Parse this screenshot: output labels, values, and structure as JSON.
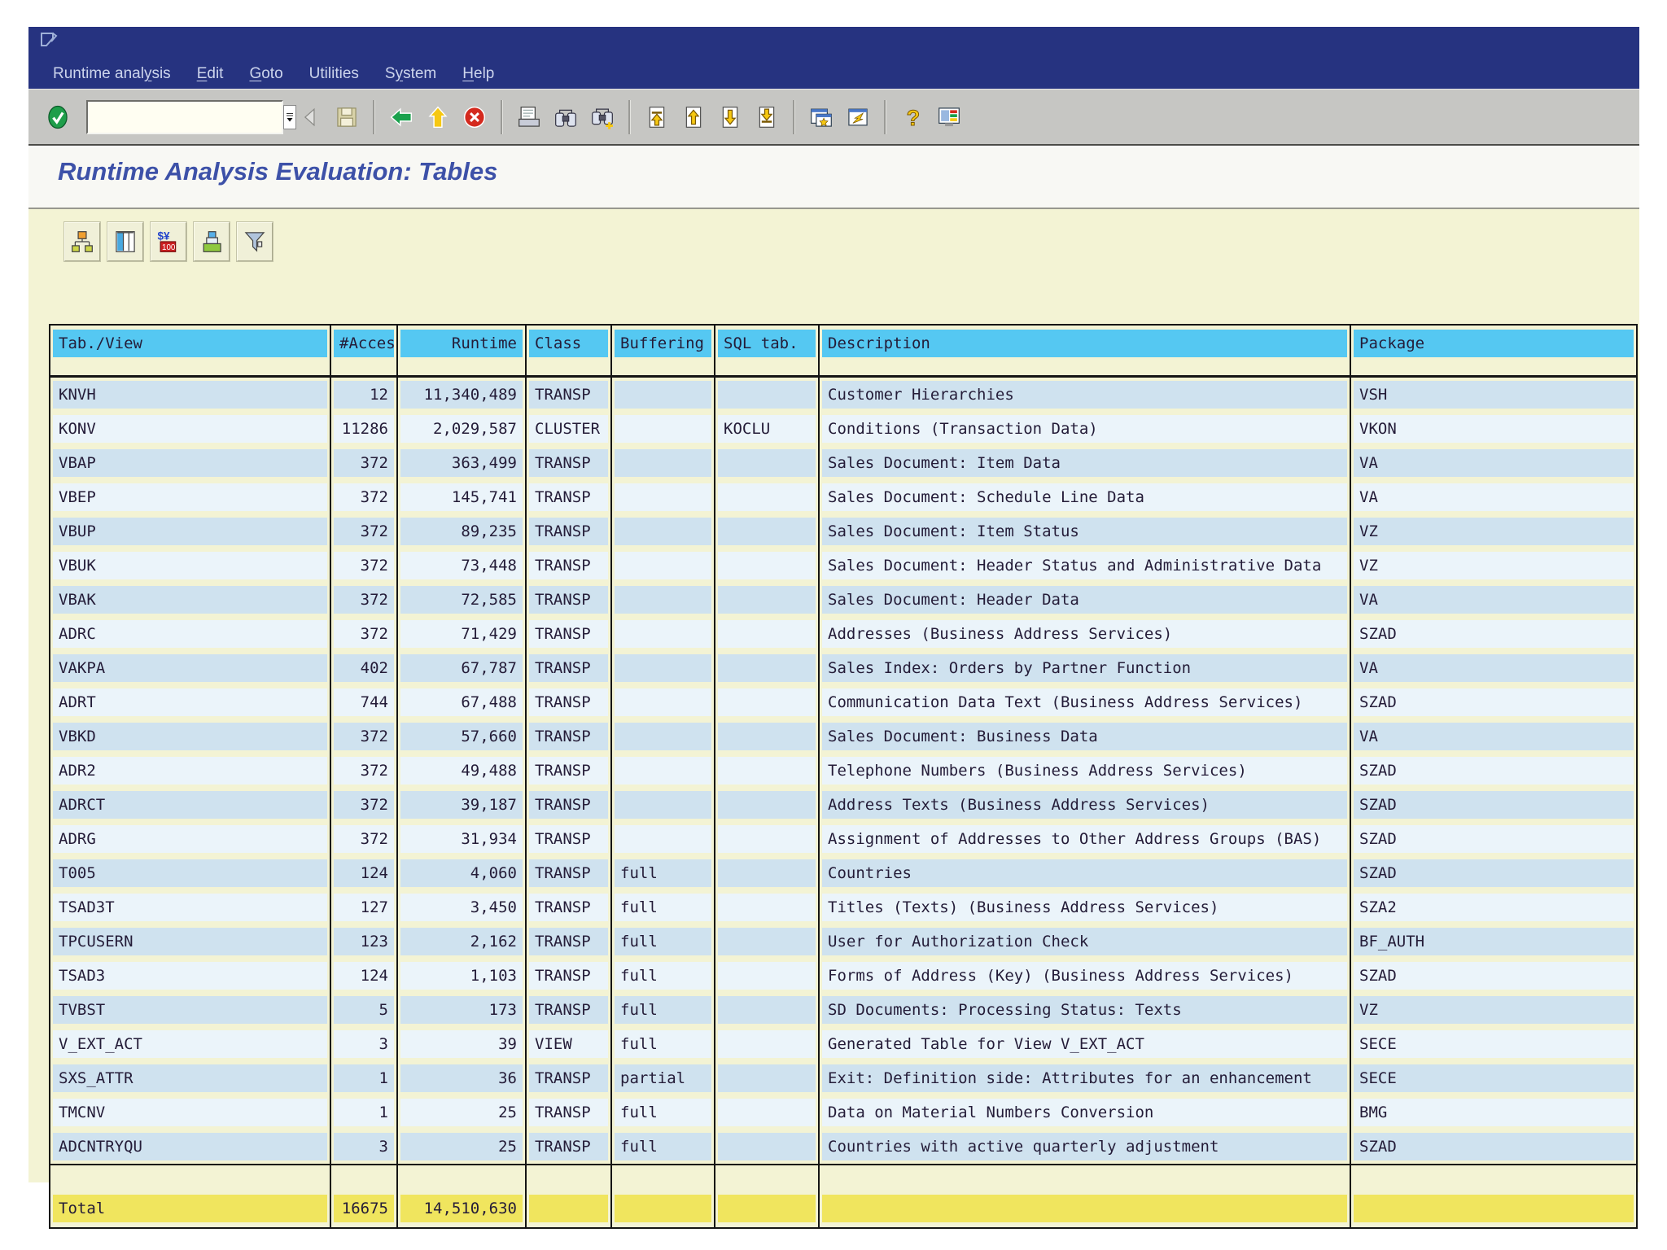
{
  "colors": {
    "titlebar": "#263380",
    "canvas": "#f3f3d4",
    "header_band": "#55c8f2",
    "row_odd": "#cfe2ef",
    "row_even": "#ebf4fa",
    "total_band": "#f0e55e",
    "title_text": "#3d51a8"
  },
  "menubar": {
    "items": [
      {
        "label": "Runtime analysis",
        "accel": 12
      },
      {
        "label": "Edit",
        "accel": 0
      },
      {
        "label": "Goto",
        "accel": 0
      },
      {
        "label": "Utilities",
        "accel": -1
      },
      {
        "label": "System",
        "accel": 1
      },
      {
        "label": "Help",
        "accel": 0
      }
    ]
  },
  "toolbar": {
    "command_value": "",
    "buttons": [
      "check",
      "command",
      "enter-arrow",
      "save",
      "sep",
      "back",
      "exit",
      "cancel",
      "sep",
      "print",
      "find",
      "find-next",
      "sep",
      "first-page",
      "page-up",
      "page-down",
      "last-page",
      "sep",
      "new-session",
      "shortcut",
      "sep",
      "help",
      "customize"
    ]
  },
  "page_title": "Runtime Analysis Evaluation: Tables",
  "app_toolbar": {
    "buttons": [
      "hierarchy",
      "table-view",
      "currency",
      "sort",
      "filter"
    ]
  },
  "table": {
    "columns": [
      {
        "key": "tab",
        "label": "Tab./View",
        "header_align": "left",
        "align": "left"
      },
      {
        "key": "acces",
        "label": "#Acces",
        "header_align": "left",
        "align": "right"
      },
      {
        "key": "runtime",
        "label": "Runtime",
        "header_align": "right",
        "align": "right"
      },
      {
        "key": "class",
        "label": "Class",
        "header_align": "left",
        "align": "left"
      },
      {
        "key": "buffering",
        "label": "Buffering",
        "header_align": "left",
        "align": "left"
      },
      {
        "key": "sql",
        "label": "SQL tab.",
        "header_align": "left",
        "align": "left"
      },
      {
        "key": "desc",
        "label": "Description",
        "header_align": "left",
        "align": "left"
      },
      {
        "key": "pkg",
        "label": "Package",
        "header_align": "left",
        "align": "left"
      }
    ],
    "rows": [
      {
        "tab": "KNVH",
        "acces": "12",
        "runtime": "11,340,489",
        "class": "TRANSP",
        "buffering": "",
        "sql": "",
        "desc": "Customer Hierarchies",
        "pkg": "VSH"
      },
      {
        "tab": "KONV",
        "acces": "11286",
        "runtime": "2,029,587",
        "class": "CLUSTER",
        "buffering": "",
        "sql": "KOCLU",
        "desc": "Conditions (Transaction Data)",
        "pkg": "VKON"
      },
      {
        "tab": "VBAP",
        "acces": "372",
        "runtime": "363,499",
        "class": "TRANSP",
        "buffering": "",
        "sql": "",
        "desc": "Sales Document: Item Data",
        "pkg": "VA"
      },
      {
        "tab": "VBEP",
        "acces": "372",
        "runtime": "145,741",
        "class": "TRANSP",
        "buffering": "",
        "sql": "",
        "desc": "Sales Document: Schedule Line Data",
        "pkg": "VA"
      },
      {
        "tab": "VBUP",
        "acces": "372",
        "runtime": "89,235",
        "class": "TRANSP",
        "buffering": "",
        "sql": "",
        "desc": "Sales Document: Item Status",
        "pkg": "VZ"
      },
      {
        "tab": "VBUK",
        "acces": "372",
        "runtime": "73,448",
        "class": "TRANSP",
        "buffering": "",
        "sql": "",
        "desc": "Sales Document: Header Status and Administrative Data",
        "pkg": "VZ"
      },
      {
        "tab": "VBAK",
        "acces": "372",
        "runtime": "72,585",
        "class": "TRANSP",
        "buffering": "",
        "sql": "",
        "desc": "Sales Document: Header Data",
        "pkg": "VA"
      },
      {
        "tab": "ADRC",
        "acces": "372",
        "runtime": "71,429",
        "class": "TRANSP",
        "buffering": "",
        "sql": "",
        "desc": "Addresses (Business Address Services)",
        "pkg": "SZAD"
      },
      {
        "tab": "VAKPA",
        "acces": "402",
        "runtime": "67,787",
        "class": "TRANSP",
        "buffering": "",
        "sql": "",
        "desc": "Sales Index: Orders by Partner Function",
        "pkg": "VA"
      },
      {
        "tab": "ADRT",
        "acces": "744",
        "runtime": "67,488",
        "class": "TRANSP",
        "buffering": "",
        "sql": "",
        "desc": "Communication Data Text (Business Address Services)",
        "pkg": "SZAD"
      },
      {
        "tab": "VBKD",
        "acces": "372",
        "runtime": "57,660",
        "class": "TRANSP",
        "buffering": "",
        "sql": "",
        "desc": "Sales Document: Business Data",
        "pkg": "VA"
      },
      {
        "tab": "ADR2",
        "acces": "372",
        "runtime": "49,488",
        "class": "TRANSP",
        "buffering": "",
        "sql": "",
        "desc": "Telephone Numbers (Business Address Services)",
        "pkg": "SZAD"
      },
      {
        "tab": "ADRCT",
        "acces": "372",
        "runtime": "39,187",
        "class": "TRANSP",
        "buffering": "",
        "sql": "",
        "desc": "Address Texts (Business Address Services)",
        "pkg": "SZAD"
      },
      {
        "tab": "ADRG",
        "acces": "372",
        "runtime": "31,934",
        "class": "TRANSP",
        "buffering": "",
        "sql": "",
        "desc": "Assignment of Addresses to Other Address Groups (BAS)",
        "pkg": "SZAD"
      },
      {
        "tab": "T005",
        "acces": "124",
        "runtime": "4,060",
        "class": "TRANSP",
        "buffering": "full",
        "sql": "",
        "desc": "Countries",
        "pkg": "SZAD"
      },
      {
        "tab": "TSAD3T",
        "acces": "127",
        "runtime": "3,450",
        "class": "TRANSP",
        "buffering": "full",
        "sql": "",
        "desc": "Titles (Texts) (Business Address Services)",
        "pkg": "SZA2"
      },
      {
        "tab": "TPCUSERN",
        "acces": "123",
        "runtime": "2,162",
        "class": "TRANSP",
        "buffering": "full",
        "sql": "",
        "desc": "User for Authorization Check",
        "pkg": "BF_AUTH"
      },
      {
        "tab": "TSAD3",
        "acces": "124",
        "runtime": "1,103",
        "class": "TRANSP",
        "buffering": "full",
        "sql": "",
        "desc": "Forms of Address (Key) (Business Address Services)",
        "pkg": "SZAD"
      },
      {
        "tab": "TVBST",
        "acces": "5",
        "runtime": "173",
        "class": "TRANSP",
        "buffering": "full",
        "sql": "",
        "desc": "SD Documents: Processing Status: Texts",
        "pkg": "VZ"
      },
      {
        "tab": "V_EXT_ACT",
        "acces": "3",
        "runtime": "39",
        "class": "VIEW",
        "buffering": "full",
        "sql": "",
        "desc": "Generated Table for View V_EXT_ACT",
        "pkg": "SECE"
      },
      {
        "tab": "SXS_ATTR",
        "acces": "1",
        "runtime": "36",
        "class": "TRANSP",
        "buffering": "partial",
        "sql": "",
        "desc": "Exit: Definition side: Attributes for an enhancement",
        "pkg": "SECE"
      },
      {
        "tab": "TMCNV",
        "acces": "1",
        "runtime": "25",
        "class": "TRANSP",
        "buffering": "full",
        "sql": "",
        "desc": "Data on Material Numbers Conversion",
        "pkg": "BMG"
      },
      {
        "tab": "ADCNTRYQU",
        "acces": "3",
        "runtime": "25",
        "class": "TRANSP",
        "buffering": "full",
        "sql": "",
        "desc": "Countries with active quarterly adjustment",
        "pkg": "SZAD"
      }
    ],
    "total": {
      "tab": "Total",
      "acces": "16675",
      "runtime": "14,510,630",
      "class": "",
      "buffering": "",
      "sql": "",
      "desc": "",
      "pkg": ""
    }
  }
}
